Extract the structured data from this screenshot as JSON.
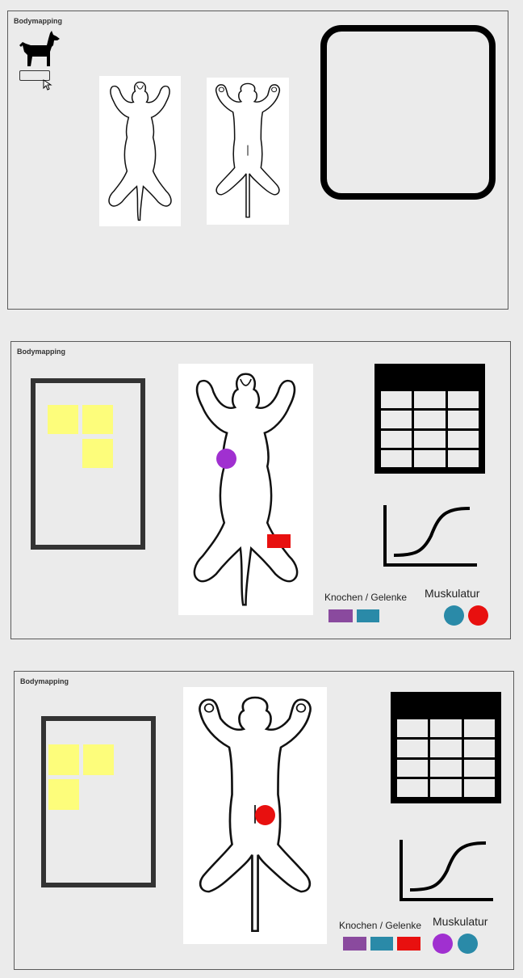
{
  "frames": [
    {
      "title": "Bodymapping"
    },
    {
      "title": "Bodymapping"
    },
    {
      "title": "Bodymapping"
    }
  ],
  "legend": {
    "bones_label": "Knochen / Gelenke",
    "muscles_label": "Muskulatur"
  },
  "colors": {
    "purple": "#8a4a9e",
    "teal": "#2a8aa8",
    "red": "#e8100f",
    "violet": "#a030d0",
    "sticky": "#fdfd7b"
  },
  "icons": [
    "dog-icon",
    "cursor-icon",
    "table-icon",
    "sigmoid-chart-icon"
  ]
}
